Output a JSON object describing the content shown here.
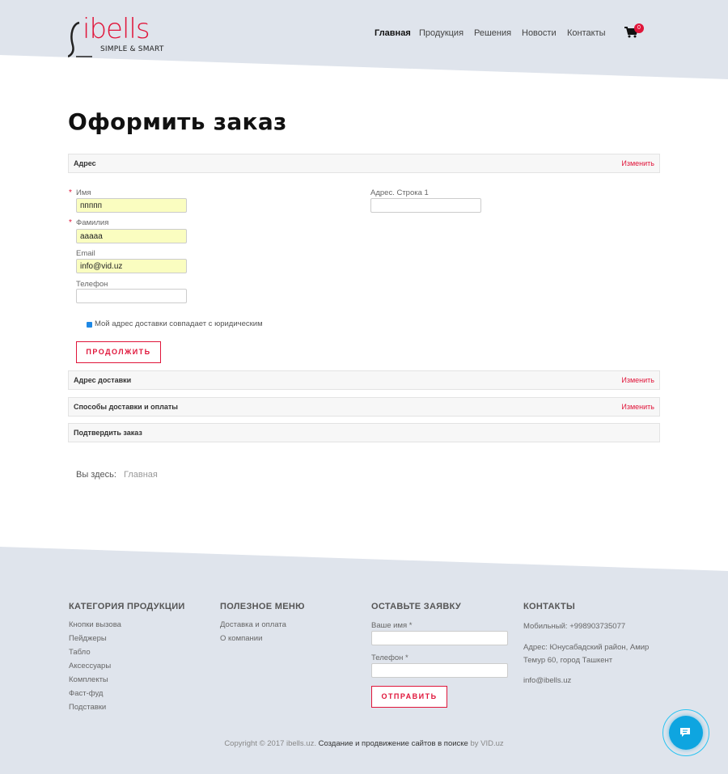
{
  "header": {
    "logo_text": "ibells",
    "logo_tagline": "SIMPLE & SMART",
    "nav": [
      "Главная",
      "Продукция",
      "Решения",
      "Новости",
      "Контакты"
    ],
    "cart_count": "0"
  },
  "main": {
    "title": "Оформить заказ",
    "steps": {
      "address": {
        "label": "Адрес",
        "change": "Изменить"
      },
      "delivery_address": {
        "label": "Адрес доставки",
        "change": "Изменить"
      },
      "shipping_payment": {
        "label": "Способы доставки и оплаты",
        "change": "Изменить"
      },
      "confirm": {
        "label": "Подтвердить заказ"
      }
    },
    "form": {
      "first_name": {
        "label": "Имя",
        "value": "ппппп"
      },
      "last_name": {
        "label": "Фамилия",
        "value": "ааааа"
      },
      "email": {
        "label": "Email",
        "value": "info@vid.uz"
      },
      "phone": {
        "label": "Телефон",
        "value": ""
      },
      "address_line1": {
        "label": "Адрес. Строка 1",
        "value": ""
      },
      "same_address_label": "Мой адрес доставки совпадает с юридическим",
      "continue_label": "ПРОДОЛЖИТЬ"
    },
    "breadcrumb": {
      "prefix": "Вы здесь:",
      "home": "Главная"
    }
  },
  "footer": {
    "categories": {
      "title": "КАТЕГОРИЯ ПРОДУКЦИИ",
      "items": [
        "Кнопки вызова",
        "Пейджеры",
        "Табло",
        "Аксессуары",
        "Комплекты",
        "Фаст-фуд",
        "Подставки"
      ]
    },
    "useful": {
      "title": "ПОЛЕЗНОЕ МЕНЮ",
      "items": [
        "Доставка и оплата",
        "О компании"
      ]
    },
    "request": {
      "title": "ОСТАВЬТЕ ЗАЯВКУ",
      "name_label": "Ваше имя *",
      "phone_label": "Телефон *",
      "submit_label": "ОТПРАВИТЬ"
    },
    "contacts": {
      "title": "КОНТАКТЫ",
      "mobile": "Мобильный: +998903735077",
      "address_line1": "Адрес: Юнусабадский район, Амир",
      "address_line2": "Темур 60, город Ташкент",
      "email": "info@ibells.uz"
    },
    "copyright": {
      "prefix": "Copyright © 2017 ibells.uz.",
      "link": "Создание и продвижение сайтов в поиске",
      "suffix": "by VID.uz"
    }
  },
  "colors": {
    "accent": "#e0153a",
    "header_bg": "#dfe4ec",
    "chat": "#0ea5e0"
  }
}
